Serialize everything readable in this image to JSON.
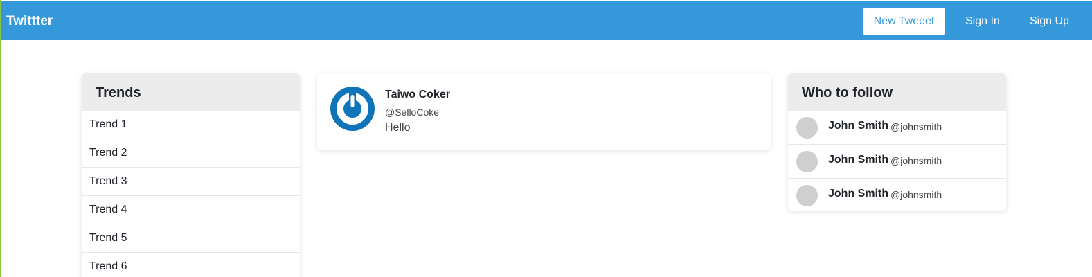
{
  "navbar": {
    "brand": "Twittter",
    "new_tweet_label": "New Tweeet",
    "sign_in_label": "Sign In",
    "sign_up_label": "Sign Up",
    "bar_color": "#3498db"
  },
  "trends": {
    "title": "Trends",
    "items": [
      {
        "label": "Trend 1"
      },
      {
        "label": "Trend 2"
      },
      {
        "label": "Trend 3"
      },
      {
        "label": "Trend 4"
      },
      {
        "label": "Trend 5"
      },
      {
        "label": "Trend 6"
      }
    ]
  },
  "tweet": {
    "author_name": "Taiwo Coker",
    "author_handle": "@SelloCoke",
    "text": "Hello",
    "avatar_icon": "power-logo-icon",
    "avatar_color": "#0f74b8"
  },
  "who_to_follow": {
    "title": "Who to follow",
    "avatar_placeholder": "....",
    "items": [
      {
        "name": "John Smith",
        "handle": "@johnsmith"
      },
      {
        "name": "John Smith",
        "handle": "@johnsmith"
      },
      {
        "name": "John Smith",
        "handle": "@johnsmith"
      }
    ]
  }
}
